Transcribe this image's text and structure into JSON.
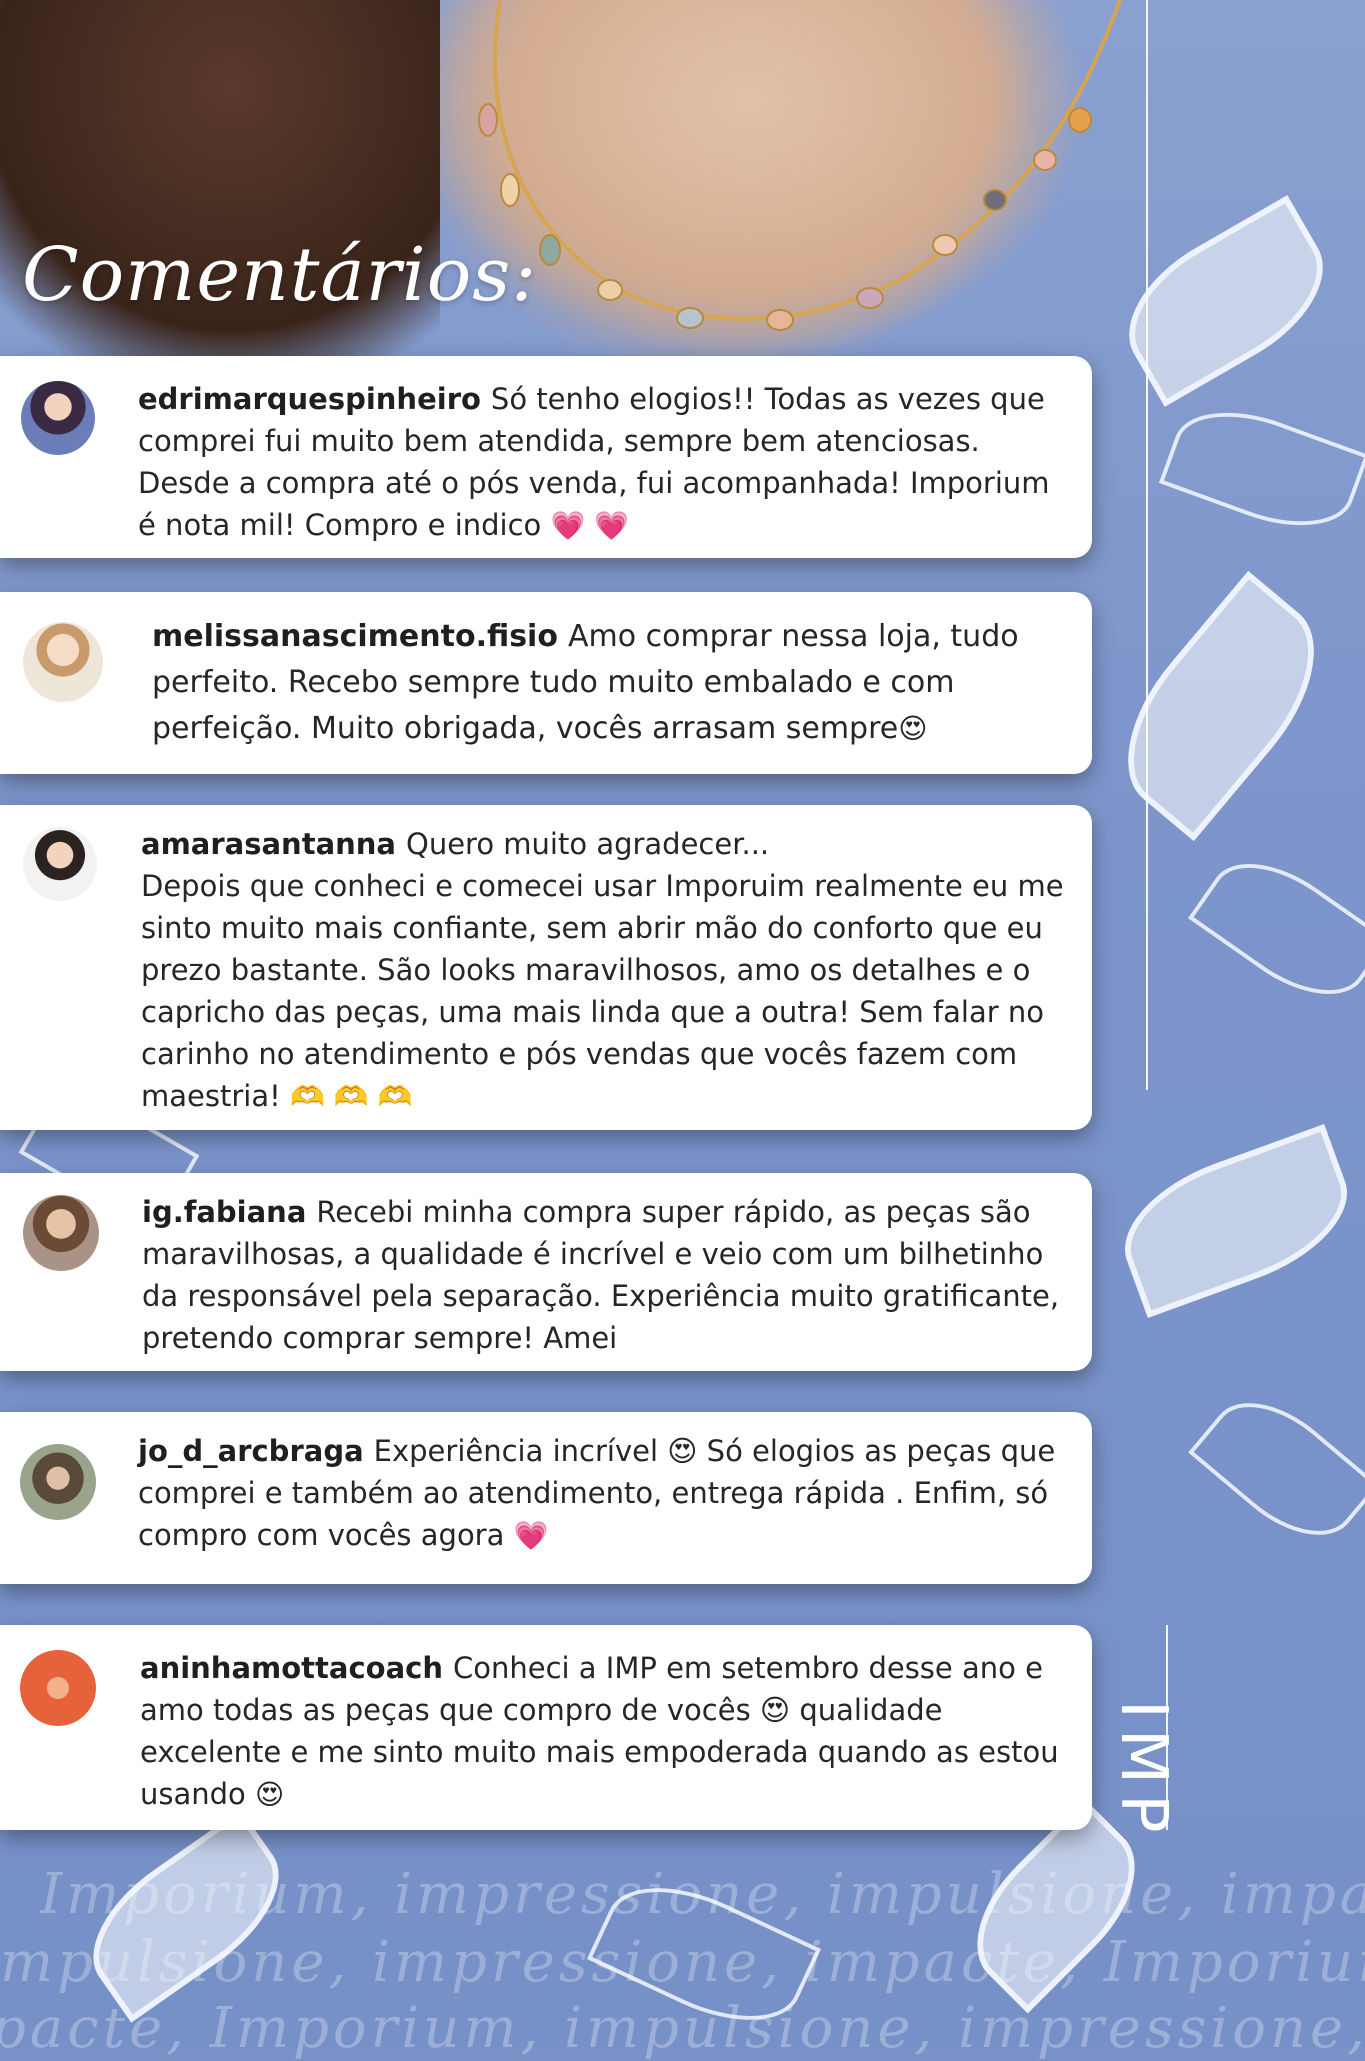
{
  "title": "Comentários:",
  "brand_logo": "IMP",
  "watermark_lines": [
    "Imporium, impressione, impulsione, impacte,",
    "mpulsione, impressione, impacte, Imporium,",
    "pacte, Imporium, impulsione, impressione, Im"
  ],
  "comments": [
    {
      "username": "edrimarquespinheiro",
      "text": "Só tenho elogios!! Todas as vezes que\ncomprei fui muito bem atendida, sempre bem atenciosas.\nDesde a compra até o pós venda, fui acompanhada! Imporium\né nota mil! Compro e indico",
      "emoji": "💗 💗"
    },
    {
      "username": "melissanascimento.fisio",
      "text": "Amo comprar nessa loja, tudo\nperfeito. Recebo sempre tudo muito embalado e com\nperfeição. Muito obrigada, vocês arrasam sempre",
      "emoji": "😍"
    },
    {
      "username": "amarasantanna",
      "text": "Quero muito agradecer...\nDepois que conheci e comecei usar Imporuim realmente eu me\nsinto muito mais confiante, sem abrir mão do conforto que eu\nprezo bastante. São looks maravilhosos, amo os detalhes e o\ncapricho das peças, uma mais linda que a outra! Sem falar no\ncarinho no atendimento e pós vendas que vocês fazem com\nmaestria!",
      "emoji": "🫶 🫶 🫶"
    },
    {
      "username": "ig.fabiana",
      "text": "Recebi minha compra super rápido, as peças são\nmaravilhosas, a qualidade é incrível e veio com um bilhetinho\nda responsável pela separação. Experiência muito gratificante,\npretendo comprar sempre! Amei",
      "emoji": ""
    },
    {
      "username": "jo_d_arcbraga",
      "text": "Experiência incrível 😍 Só elogios as peças que\ncomprei e também ao atendimento, entrega rápida . Enfim, só\ncompro com vocês agora",
      "emoji": "💗"
    },
    {
      "username": "aninhamottacoach",
      "text": "Conheci a IMP em setembro desse ano e\namo todas as peças que compro de vocês 😍 qualidade\nexcelente e me sinto muito mais empoderada quando as estou\nusando",
      "emoji": "😍"
    }
  ],
  "icons": {
    "avatar": "user-avatar-icon",
    "heart": "pink-heart-emoji",
    "heart_eyes": "heart-eyes-emoji",
    "heart_hands": "heart-hands-emoji"
  },
  "colors": {
    "background_blue": "#7b92c8",
    "card_white": "#ffffff",
    "text_dark": "#262626",
    "title_white": "#ffffff"
  }
}
